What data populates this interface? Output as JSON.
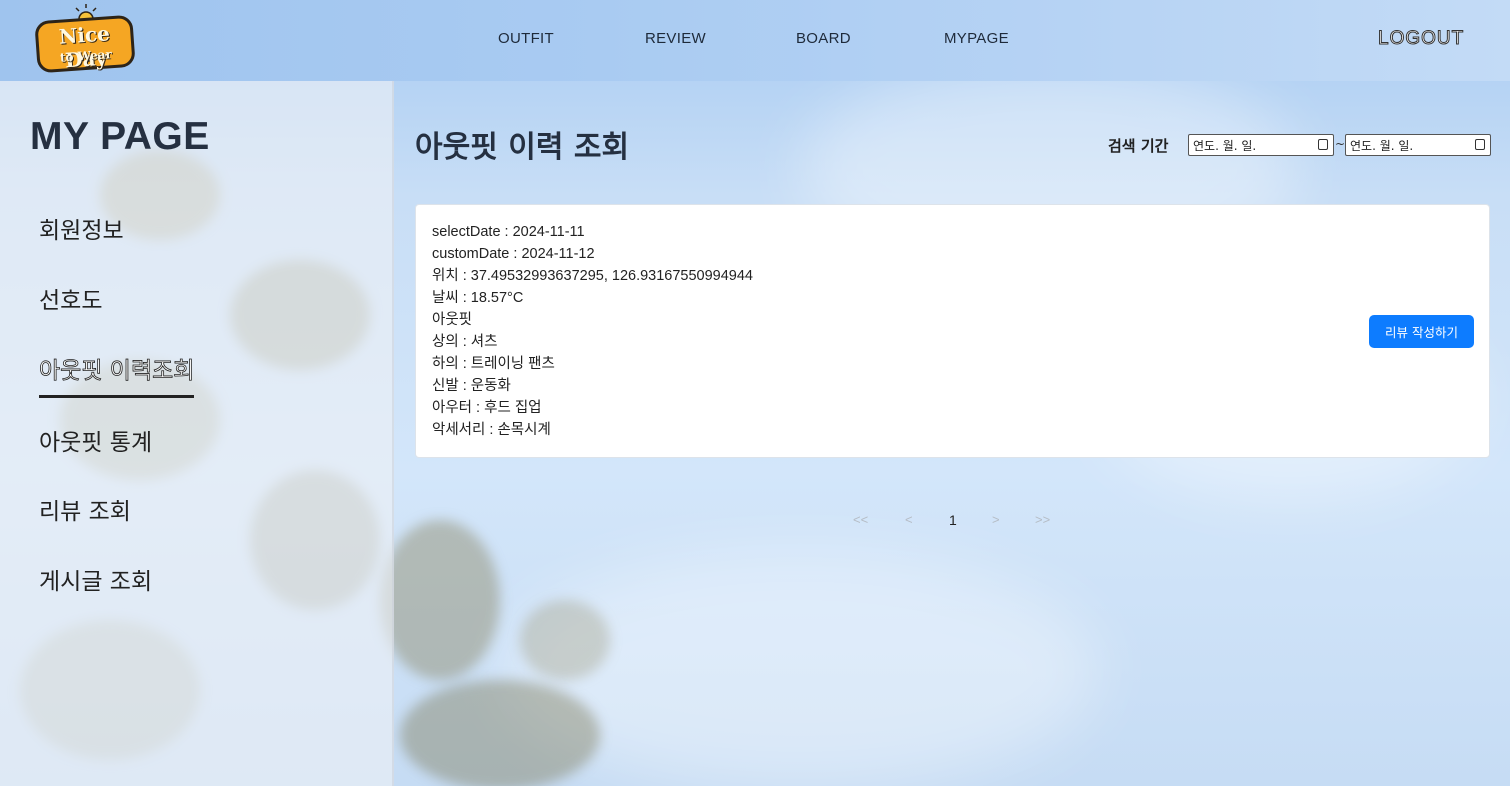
{
  "header": {
    "logo_line1": "Nice Day",
    "logo_line2": "to Wear",
    "nav": [
      "OUTFIT",
      "REVIEW",
      "BOARD",
      "MYPAGE"
    ],
    "logout_label": "LOGOUT"
  },
  "sidebar": {
    "title": "MY PAGE",
    "items": [
      {
        "label": "회원정보",
        "active": false
      },
      {
        "label": "선호도",
        "active": false
      },
      {
        "label": "아웃핏 이력조회",
        "active": true
      },
      {
        "label": "아웃핏 통계",
        "active": false
      },
      {
        "label": "리뷰 조회",
        "active": false
      },
      {
        "label": "게시글 조회",
        "active": false
      }
    ]
  },
  "main": {
    "title": "아웃핏 이력 조회",
    "search_period_label": "검색 기간",
    "date_from_placeholder": "연도. 월. 일.",
    "date_separator": "~",
    "date_to_placeholder": "연도. 월. 일.",
    "records": [
      {
        "lines": [
          "selectDate : 2024-11-11",
          "customDate : 2024-11-12",
          "위치 : 37.49532993637295, 126.93167550994944",
          "날씨 : 18.57°C",
          "아웃핏",
          "상의 : 셔츠",
          "하의 : 트레이닝 팬츠",
          "신발 : 운동화",
          "아우터 : 후드 집업",
          "악세서리 : 손목시계"
        ],
        "review_button_label": "리뷰 작성하기"
      }
    ],
    "pagination": {
      "first": "<<",
      "prev": "<",
      "current_page": "1",
      "next": ">",
      "last": ">>"
    }
  },
  "colors": {
    "accent": "#0d7cff",
    "logo_orange": "#f5a623",
    "title_text": "#253041"
  }
}
